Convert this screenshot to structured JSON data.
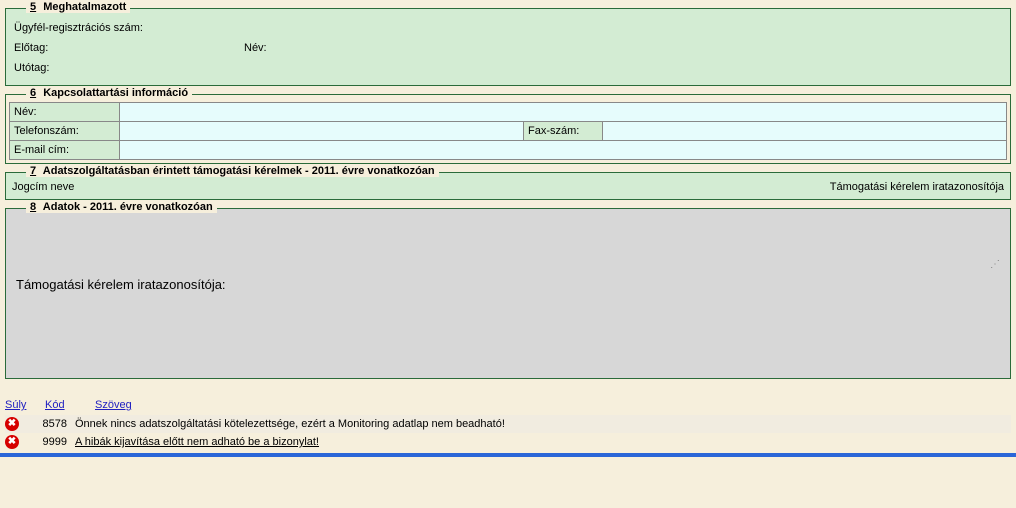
{
  "section5": {
    "num": "5",
    "title": "Meghatalmazott",
    "labels": {
      "regszam": "Ügyfél-regisztrációs szám:",
      "elotag": "Előtag:",
      "nev": "Név:",
      "utotag": "Utótag:"
    }
  },
  "section6": {
    "num": "6",
    "title": "Kapcsolattartási információ",
    "labels": {
      "nev": "Név:",
      "telefon": "Telefonszám:",
      "fax": "Fax-szám:",
      "email": "E-mail cím:"
    },
    "values": {
      "nev": "",
      "telefon": "",
      "fax": "",
      "email": ""
    }
  },
  "section7": {
    "num": "7",
    "title": "Adatszolgáltatásban érintett támogatási kérelmek - 2011. évre vonatkozóan",
    "col_left": "Jogcím neve",
    "col_right": "Támogatási kérelem iratazonosítója"
  },
  "section8": {
    "num": "8",
    "title": "Adatok - 2011. évre vonatkozóan",
    "body": "Támogatási kérelem iratazonosítója:"
  },
  "errors": {
    "headers": {
      "suly": "Súly",
      "kod": "Kód",
      "szoveg": "Szöveg"
    },
    "rows": [
      {
        "code": "8578",
        "text": "Önnek nincs adatszolgáltatási kötelezettsége, ezért a Monitoring adatlap nem beadható!",
        "underline": false
      },
      {
        "code": "9999",
        "text": "A hibák kijavítása előtt nem adható be a bizonylat!",
        "underline": true
      }
    ]
  }
}
